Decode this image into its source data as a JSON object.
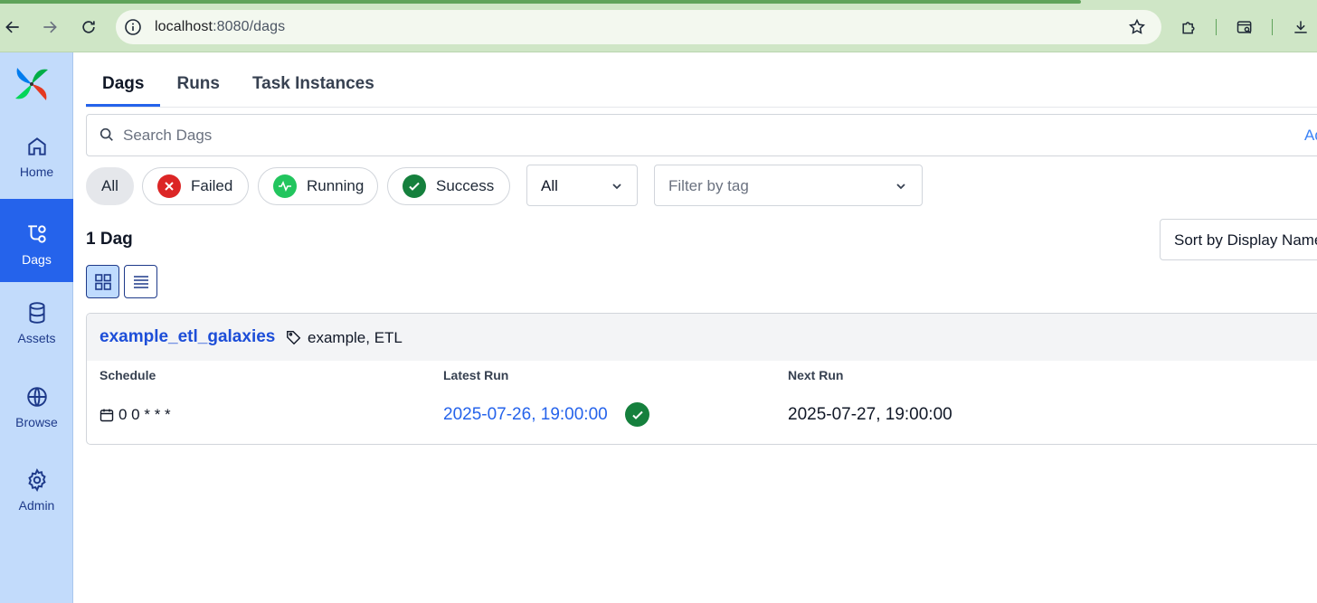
{
  "browser": {
    "url_host": "localhost",
    "url_rest": ":8080/dags"
  },
  "sidebar": {
    "items": [
      {
        "label": "Home",
        "icon": "home-icon"
      },
      {
        "label": "Dags",
        "icon": "dags-icon",
        "active": true
      },
      {
        "label": "Assets",
        "icon": "database-icon"
      },
      {
        "label": "Browse",
        "icon": "globe-icon"
      },
      {
        "label": "Admin",
        "icon": "gear-icon"
      }
    ]
  },
  "tabs": [
    {
      "label": "Dags",
      "active": true
    },
    {
      "label": "Runs"
    },
    {
      "label": "Task Instances"
    }
  ],
  "search": {
    "placeholder": "Search Dags",
    "advanced_label": "Ad"
  },
  "filters": {
    "state_chips": [
      {
        "label": "All",
        "selected": true
      },
      {
        "label": "Failed",
        "color": "#dc2626"
      },
      {
        "label": "Running",
        "color": "#22c55e"
      },
      {
        "label": "Success",
        "color": "#15803d"
      }
    ],
    "paused_select": "All",
    "tag_select_placeholder": "Filter by tag"
  },
  "dag_count": "1 Dag",
  "sort_label": "Sort by Display Name",
  "view_modes": [
    "card-view",
    "list-view"
  ],
  "dags": [
    {
      "name": "example_etl_galaxies",
      "tags": "example, ETL",
      "schedule_header": "Schedule",
      "latest_run_header": "Latest Run",
      "next_run_header": "Next Run",
      "schedule": "0 0 * * *",
      "latest_run": "2025-07-26, 19:00:00",
      "latest_run_state": "success",
      "next_run": "2025-07-27, 19:00:00"
    }
  ],
  "colors": {
    "accent": "#2563eb",
    "sidebar_bg": "#c2dbfb",
    "chrome_bg": "#cfe6c6"
  }
}
